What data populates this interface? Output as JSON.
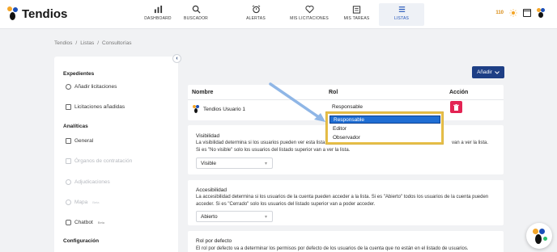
{
  "app": {
    "name": "Tendios"
  },
  "nav": {
    "items": [
      {
        "label": "DASHBOARD",
        "icon": "bar-chart-icon"
      },
      {
        "label": "BUSCADOR",
        "icon": "search-icon"
      },
      {
        "label": "ALERTAS",
        "icon": "alarm-clock-icon"
      },
      {
        "label": "MIS LICITACIONES",
        "icon": "heart-icon"
      },
      {
        "label": "MIS TAREAS",
        "icon": "clipboard-icon"
      },
      {
        "label": "LISTAS",
        "icon": "list-icon",
        "active": true
      }
    ],
    "credits": "110"
  },
  "breadcrumb": {
    "items": [
      "Tendios",
      "/",
      "Listas",
      "/",
      "Consultorías"
    ]
  },
  "sidebar": {
    "sections": {
      "expedientes": "Expedientes",
      "analiticas": "Analíticas",
      "configuracion": "Configuración"
    },
    "items": {
      "anadir_licitaciones": "Añadir licitaciones",
      "licitaciones_anadidas": "Licitaciones añadidas",
      "general": "General",
      "organos": "Órganos de contratación",
      "adjudicaciones": "Adjudicaciones",
      "mapa": "Mapa",
      "mapa_badge": "Beta",
      "chatbot": "Chatbot",
      "chatbot_badge": "Beta"
    }
  },
  "main": {
    "add_button": "Añadir",
    "table": {
      "headers": {
        "nombre": "Nombre",
        "rol": "Rol",
        "accion": "Acción"
      },
      "rows": [
        {
          "nombre": "Tendios Usuario 1",
          "rol": "Responsable"
        }
      ]
    },
    "dropdown": {
      "options": [
        "Responsable",
        "Editor",
        "Observador"
      ],
      "selected": "Responsable"
    },
    "visibilidad": {
      "title": "Visibilidad",
      "desc1": "La visibilidad determina si los usuarios pueden ver esta lista",
      "desc1_tail": "van a ver la lista.",
      "desc2": "Si es \"No visible\" solo los usuarios del listado superior van a ver la lista.",
      "value": "Visible"
    },
    "accesibilidad": {
      "title": "Accesibilidad",
      "desc1": "La accesibilidad determina si los usuarios de la cuenta pueden acceder a la lista. Si es \"Abierto\" todos los usuarios de la cuenta pueden",
      "desc2": "acceder. Si es \"Cerrado\" solo los usuarios del listado superior van a poder acceder.",
      "value": "Abierto"
    },
    "rol_defecto": {
      "title": "Rol por defecto",
      "desc1": "El rol por defecto va a determinar los permisos por defecto de los usuarios de la cuenta que no están en el listado de usuarios."
    }
  },
  "colors": {
    "primary": "#1e3f85",
    "danger": "#e32353",
    "highlight": "#e8c04a",
    "selection": "#1f6ed4",
    "accent_orange": "#f4a629"
  }
}
